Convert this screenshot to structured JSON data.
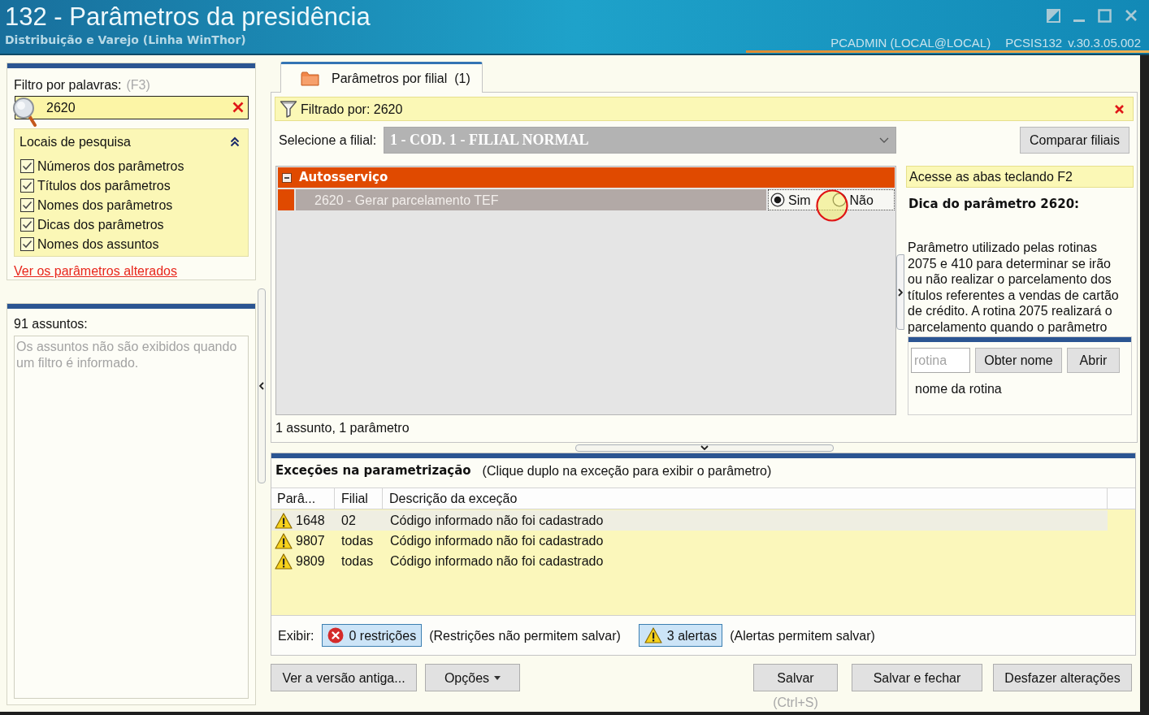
{
  "window": {
    "title": "132 - Parâmetros da presidência",
    "subtitle": "Distribuição e Varejo (Linha WinThor)",
    "user": "PCADMIN (LOCAL@LOCAL)",
    "module": "PCSIS132",
    "version": "v.30.3.05.002"
  },
  "filter_panel": {
    "label": "Filtro por palavras:",
    "shortcut": "(F3)",
    "search": {
      "value": "2620"
    },
    "search_locations": {
      "title": "Locais de pesquisa",
      "expanded": true,
      "options": [
        {
          "label": "Números dos parâmetros",
          "checked": true
        },
        {
          "label": "Títulos dos parâmetros",
          "checked": true
        },
        {
          "label": "Nomes dos parâmetros",
          "checked": true
        },
        {
          "label": "Dicas dos parâmetros",
          "checked": true
        },
        {
          "label": "Nomes dos assuntos",
          "checked": true
        }
      ]
    },
    "link": "Ver os parâmetros alterados"
  },
  "subjects_panel": {
    "count": "91 assuntos:",
    "message": "Os assuntos não são exibidos quando um filtro é informado."
  },
  "tabs": [
    {
      "label": "Parâmetros por filial  (1)",
      "selected": true
    }
  ],
  "filter_bar": {
    "text": "Filtrado por: 2620"
  },
  "branch": {
    "label": "Selecione a filial:",
    "value": "1 - COD. 1 - FILIAL NORMAL",
    "disabled": true
  },
  "compare_button": "Comparar filiais",
  "groups": [
    {
      "name": "Autosserviço",
      "expanded": true,
      "parameters": [
        {
          "title": "2620 - Gerar parcelamento TEF",
          "options": [
            {
              "label": "Sim",
              "selected": true
            },
            {
              "label": "Não",
              "selected": false
            }
          ]
        }
      ]
    }
  ],
  "summary": "1 assunto, 1 parâmetro",
  "tip_panel": {
    "hint": "Acesse as abas teclando F2",
    "title": "Dica do parâmetro 2620:",
    "text": "Parâmetro utilizado pelas rotinas 2075 e 410 para determinar se irão ou não realizar o parcelamento dos títulos referentes a vendas de cartão de crédito. A rotina 2075 realizará o parcelamento quando o parâmetro"
  },
  "routine": {
    "placeholder": "rotina",
    "buttons": [
      "Obter nome",
      "Abrir"
    ],
    "name": "nome da rotina"
  },
  "exceptions": {
    "title": "Exceções na parametrização",
    "hint": "(Clique duplo na exceção para exibir o parâmetro)",
    "columns": [
      "Parâ...",
      "Filial",
      "Descrição da exceção"
    ],
    "rows": [
      {
        "kind": "alert",
        "selected": true,
        "cells": [
          "1648",
          "02",
          "Código informado não foi cadastrado"
        ]
      },
      {
        "kind": "alert",
        "selected": false,
        "cells": [
          "9807",
          "todas",
          "Código informado não foi cadastrado"
        ]
      },
      {
        "kind": "alert",
        "selected": false,
        "cells": [
          "9809",
          "todas",
          "Código informado não foi cadastrado"
        ]
      }
    ],
    "show_label": "Exibir:",
    "toggles": [
      {
        "kind": "restriction",
        "label": "0 restrições",
        "on": true,
        "note": "(Restrições não permitem salvar)"
      },
      {
        "kind": "alert",
        "label": "3 alertas",
        "on": true,
        "note": "(Alertas permitem salvar)"
      }
    ]
  },
  "footer": {
    "left_buttons": [
      {
        "label": "Ver a versão antiga...",
        "dropdown": false
      },
      {
        "label": "Opções",
        "dropdown": true
      }
    ],
    "right_buttons": [
      {
        "label": "Salvar",
        "shortcut": "(Ctrl+S)"
      },
      {
        "label": "Salvar e fechar"
      },
      {
        "label": "Desfazer alterações"
      }
    ]
  }
}
